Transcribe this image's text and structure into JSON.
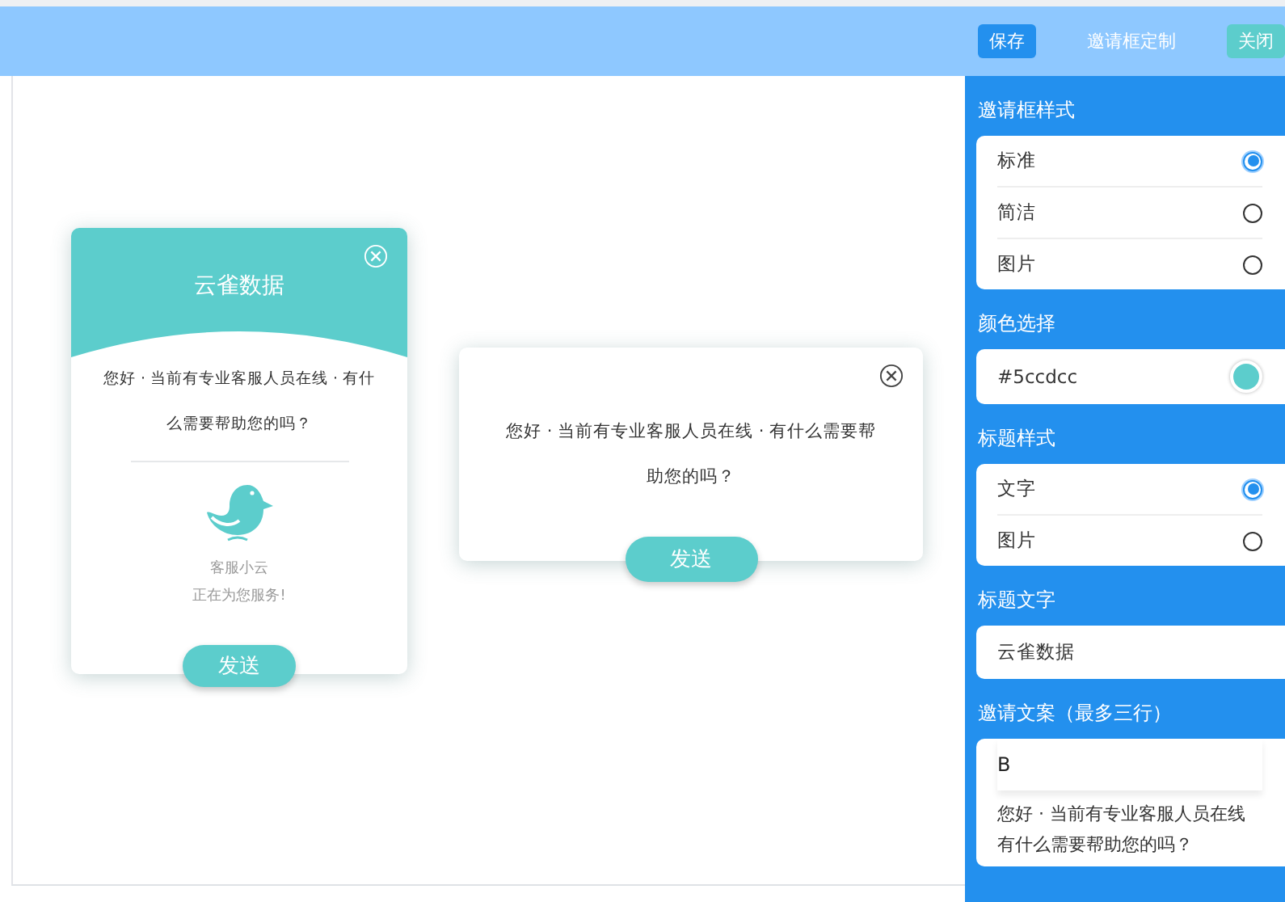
{
  "header": {
    "save_button": "保存",
    "title": "邀请框定制",
    "close_button": "关闭"
  },
  "previews": [
    {
      "kind": "standard",
      "title": "云雀数据",
      "message": "您好 · 当前有专业客服人员在线 · 有什么需要帮助您的吗？",
      "agent_name": "客服小云",
      "agent_status": "正在为您服务!",
      "send_button": "发送"
    },
    {
      "kind": "simple",
      "message": "您好 · 当前有专业客服人员在线 · 有什么需要帮助您的吗？",
      "send_button": "发送"
    }
  ],
  "settings": [
    {
      "kind": "radio",
      "label": "邀请框样式",
      "options": [
        {
          "label": "标准",
          "selected": true
        },
        {
          "label": "简洁",
          "selected": false
        },
        {
          "label": "图片",
          "selected": false
        }
      ]
    },
    {
      "kind": "color",
      "label": "颜色选择",
      "value": "#5ccdcc",
      "color": "#5ccdcc"
    },
    {
      "kind": "radio",
      "label": "标题样式",
      "options": [
        {
          "label": "文字",
          "selected": true
        },
        {
          "label": "图片",
          "selected": false
        }
      ]
    },
    {
      "kind": "text",
      "label": "标题文字",
      "value": "云雀数据"
    },
    {
      "kind": "rich",
      "label": "邀请文案（最多三行）",
      "toolbar": "B",
      "lines": [
        "您好 · 当前有专业客服人员在线",
        "有什么需要帮助您的吗？"
      ]
    }
  ]
}
